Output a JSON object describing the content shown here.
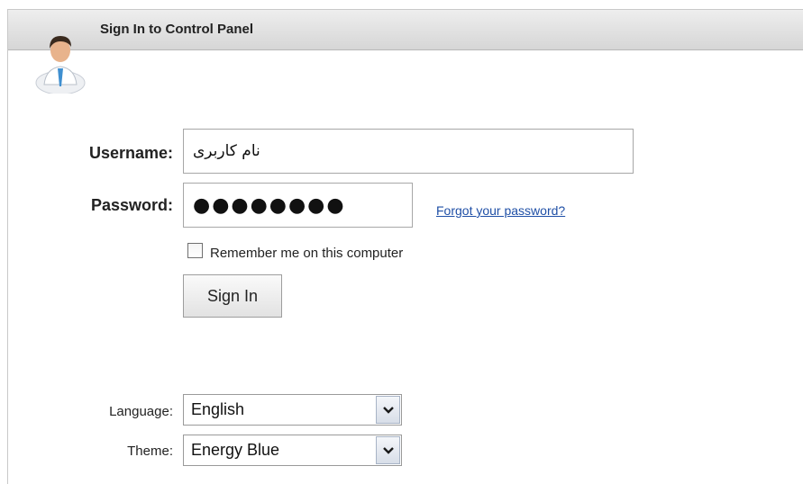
{
  "header": {
    "title": "Sign In to Control Panel"
  },
  "form": {
    "username_label": "Username:",
    "username_value": "نام کاربری",
    "password_label": "Password:",
    "password_value": "●●●●●●●●",
    "forgot_link": "Forgot your password?",
    "remember_label": "Remember me on this computer",
    "remember_checked": false,
    "signin_button": "Sign In"
  },
  "settings": {
    "language_label": "Language:",
    "language_value": "English",
    "theme_label": "Theme:",
    "theme_value": "Energy Blue"
  },
  "icons": {
    "avatar": "user-avatar-icon",
    "dropdown": "chevron-down-icon"
  },
  "colors": {
    "link": "#1f4fa6",
    "header_bg": "#dcdcdc"
  }
}
